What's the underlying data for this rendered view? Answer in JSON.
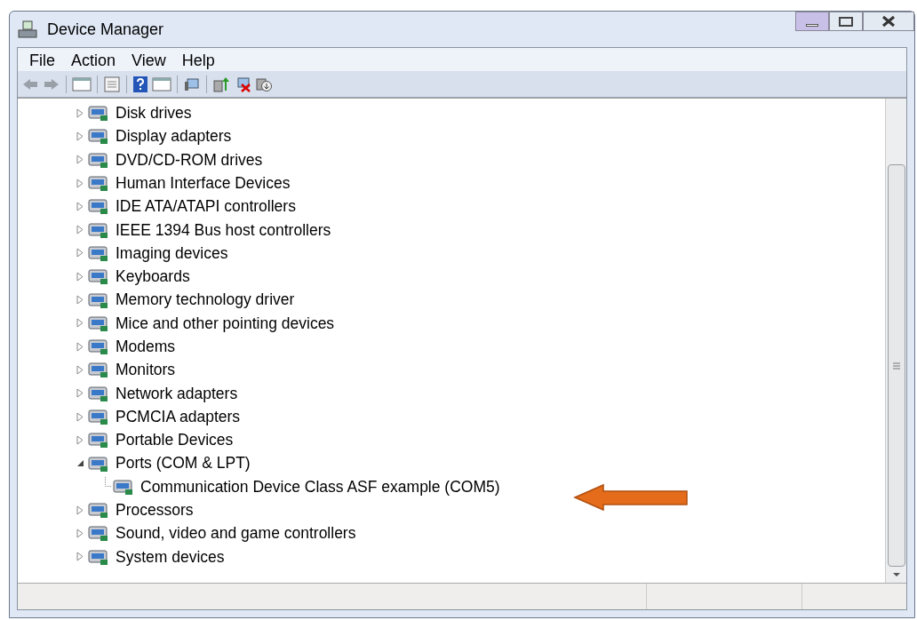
{
  "window": {
    "title": "Device Manager"
  },
  "menu": [
    "File",
    "Action",
    "View",
    "Help"
  ],
  "tree": [
    {
      "label": "Disk drives",
      "expanded": false
    },
    {
      "label": "Display adapters",
      "expanded": false
    },
    {
      "label": "DVD/CD-ROM drives",
      "expanded": false
    },
    {
      "label": "Human Interface Devices",
      "expanded": false
    },
    {
      "label": "IDE ATA/ATAPI controllers",
      "expanded": false
    },
    {
      "label": "IEEE 1394 Bus host controllers",
      "expanded": false
    },
    {
      "label": "Imaging devices",
      "expanded": false
    },
    {
      "label": "Keyboards",
      "expanded": false
    },
    {
      "label": "Memory technology driver",
      "expanded": false
    },
    {
      "label": "Mice and other pointing devices",
      "expanded": false
    },
    {
      "label": "Modems",
      "expanded": false
    },
    {
      "label": "Monitors",
      "expanded": false
    },
    {
      "label": "Network adapters",
      "expanded": false
    },
    {
      "label": "PCMCIA adapters",
      "expanded": false
    },
    {
      "label": "Portable Devices",
      "expanded": false
    },
    {
      "label": "Ports (COM & LPT)",
      "expanded": true,
      "children": [
        {
          "label": "Communication Device Class ASF example (COM5)"
        }
      ]
    },
    {
      "label": "Processors",
      "expanded": false
    },
    {
      "label": "Sound, video and game controllers",
      "expanded": false
    },
    {
      "label": "System devices",
      "expanded": false
    }
  ]
}
